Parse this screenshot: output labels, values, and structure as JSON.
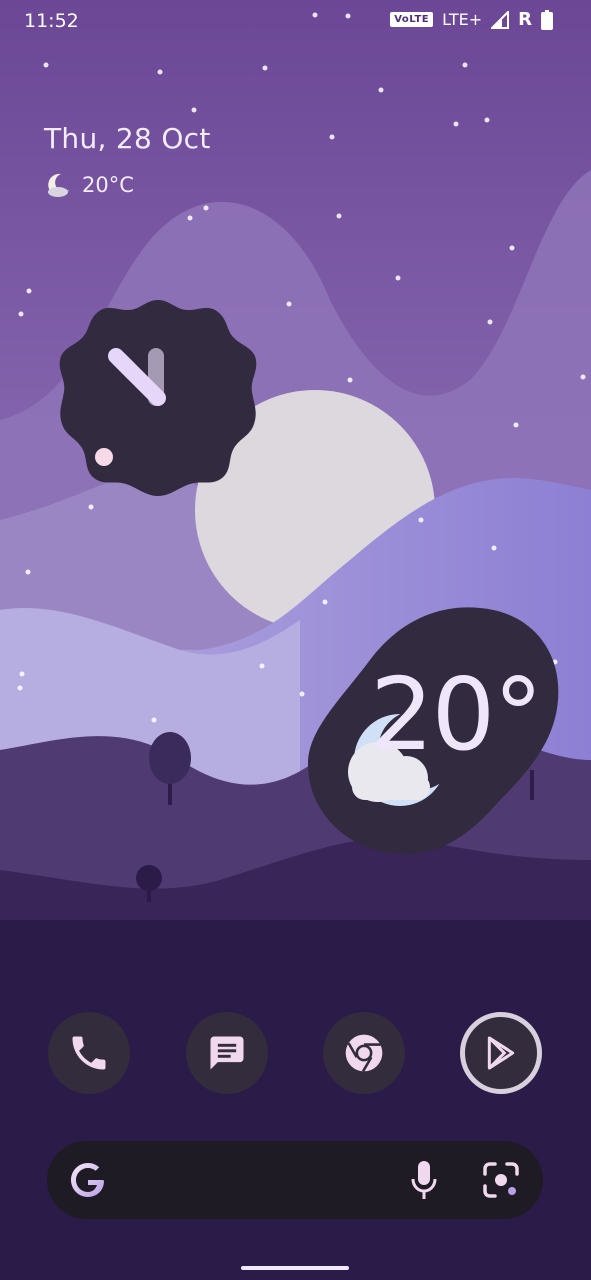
{
  "status_bar": {
    "time": "11:52",
    "volte_label": "VoLTE",
    "network_label": "LTE+",
    "roaming_label": "R",
    "icons": [
      "signal-icon",
      "battery-icon"
    ]
  },
  "at_a_glance": {
    "date": "Thu, 28 Oct",
    "temperature": "20°C",
    "weather_icon": "moon-icon"
  },
  "clock_widget": {
    "hour": 11,
    "minute": 52
  },
  "weather_widget": {
    "temperature": "20°",
    "condition_icon": "partly-cloudy-night-icon"
  },
  "dock": {
    "apps": [
      "phone-icon",
      "messages-icon",
      "chrome-icon",
      "play-store-icon"
    ]
  },
  "search_bar": {
    "icons": [
      "google-icon",
      "microphone-icon",
      "lens-icon"
    ]
  },
  "colors": {
    "sky_top": "#6d4a9a",
    "sky_bottom": "#a99bd0",
    "widget_dark": "#322a3e",
    "accent_pink": "#f7d9e8",
    "accent_lavender": "#e6d6fa"
  }
}
